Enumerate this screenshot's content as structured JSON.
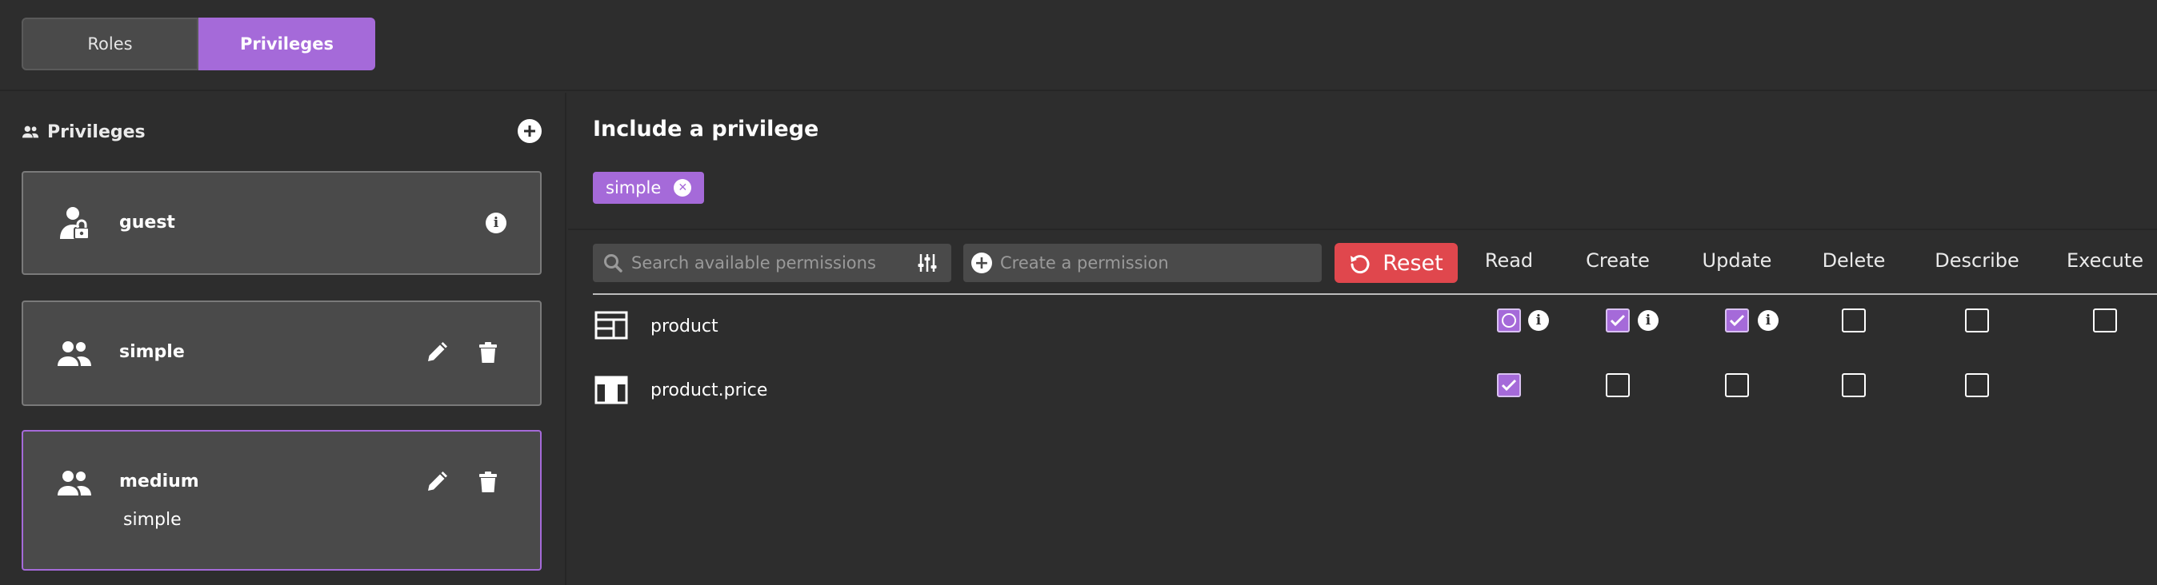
{
  "tabs": {
    "roles": "Roles",
    "privileges": "Privileges"
  },
  "left": {
    "header_title": "Privileges",
    "header_icon": "people-icon",
    "cards": [
      {
        "name": "guest",
        "icon": "user-lock-icon",
        "action": "info-icon"
      },
      {
        "name": "simple",
        "icon": "people-icon",
        "actions": [
          "edit-icon",
          "trash-icon"
        ]
      },
      {
        "name": "medium",
        "subtitle": "simple",
        "icon": "people-icon",
        "actions": [
          "edit-icon",
          "trash-icon"
        ]
      }
    ]
  },
  "right": {
    "include_title": "Include a privilege",
    "chip_label": "simple",
    "search_placeholder": "Search available permissions",
    "create_placeholder": "Create a permission",
    "reset_label": "Reset",
    "columns": [
      "Read",
      "Create",
      "Update",
      "Delete",
      "Describe",
      "Execute"
    ],
    "rows": [
      {
        "name": "product",
        "icon": "table-icon",
        "perms": {
          "Read": "partial",
          "Create": "checked",
          "Update": "checked",
          "Delete": "unchecked",
          "Describe": "unchecked",
          "Execute": "unchecked"
        }
      },
      {
        "name": "product.price",
        "icon": "grid-icon",
        "perms": {
          "Read": "checked",
          "Create": "unchecked",
          "Update": "unchecked",
          "Delete": "unchecked",
          "Describe": "unchecked"
        }
      }
    ]
  },
  "colors": {
    "accent": "#a56ad9",
    "danger": "#e0474d",
    "background": "#2d2d2d",
    "panel": "#4a4a4a"
  }
}
